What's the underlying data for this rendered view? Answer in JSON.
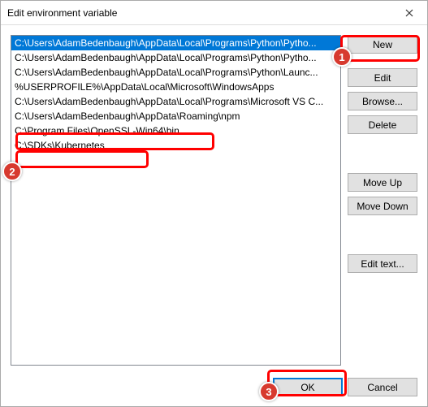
{
  "window": {
    "title": "Edit environment variable"
  },
  "list": {
    "items": [
      {
        "text": "C:\\Users\\AdamBedenbaugh\\AppData\\Local\\Programs\\Python\\Pytho...",
        "selected": true
      },
      {
        "text": "C:\\Users\\AdamBedenbaugh\\AppData\\Local\\Programs\\Python\\Pytho...",
        "selected": false
      },
      {
        "text": "C:\\Users\\AdamBedenbaugh\\AppData\\Local\\Programs\\Python\\Launc...",
        "selected": false
      },
      {
        "text": "%USERPROFILE%\\AppData\\Local\\Microsoft\\WindowsApps",
        "selected": false
      },
      {
        "text": "C:\\Users\\AdamBedenbaugh\\AppData\\Local\\Programs\\Microsoft VS C...",
        "selected": false
      },
      {
        "text": "C:\\Users\\AdamBedenbaugh\\AppData\\Roaming\\npm",
        "selected": false
      },
      {
        "text": "C:\\Program Files\\OpenSSL-Win64\\bin",
        "selected": false
      },
      {
        "text": "C:\\SDKs\\Kubernetes",
        "selected": false
      }
    ]
  },
  "buttons": {
    "new": "New",
    "edit": "Edit",
    "browse": "Browse...",
    "delete": "Delete",
    "moveup": "Move Up",
    "movedown": "Move Down",
    "edittext": "Edit text...",
    "ok": "OK",
    "cancel": "Cancel"
  },
  "annotations": {
    "b1": "1",
    "b2": "2",
    "b3": "3"
  }
}
